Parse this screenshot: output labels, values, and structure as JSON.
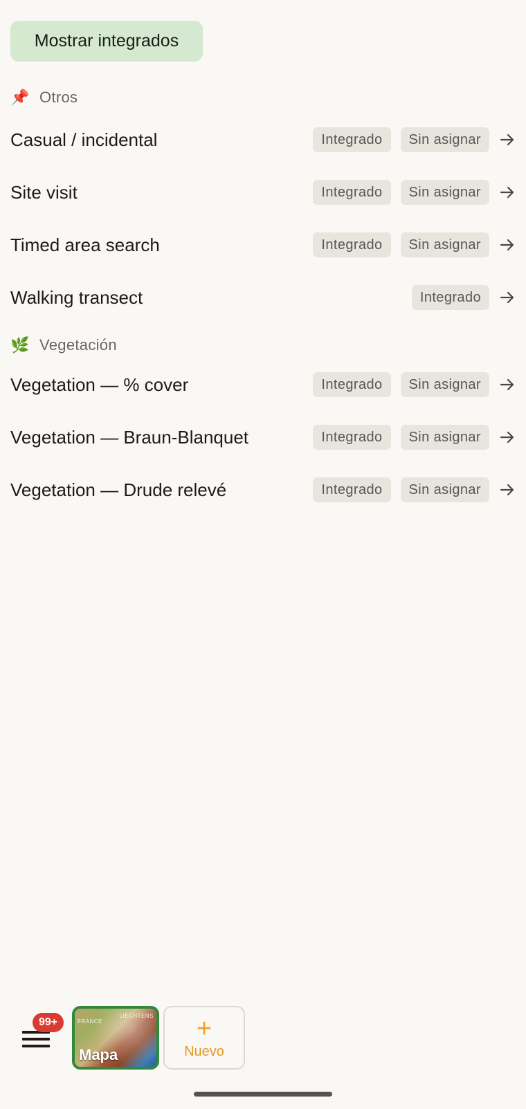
{
  "toggle_button": {
    "label": "Mostrar integrados"
  },
  "sections": [
    {
      "emoji": "📌",
      "title": "Otros",
      "items": [
        {
          "title": "Casual / incidental",
          "chips": [
            "Integrado",
            "Sin asignar"
          ]
        },
        {
          "title": "Site visit",
          "chips": [
            "Integrado",
            "Sin asignar"
          ]
        },
        {
          "title": "Timed area search",
          "chips": [
            "Integrado",
            "Sin asignar"
          ]
        },
        {
          "title": "Walking transect",
          "chips": [
            "Integrado"
          ]
        }
      ]
    },
    {
      "emoji": "🌿",
      "title": "Vegetación",
      "items": [
        {
          "title": "Vegetation — % cover",
          "chips": [
            "Integrado",
            "Sin asignar"
          ]
        },
        {
          "title": "Vegetation — Braun-Blanquet",
          "chips": [
            "Integrado",
            "Sin asignar"
          ]
        },
        {
          "title": "Vegetation — Drude relevé",
          "chips": [
            "Integrado",
            "Sin asignar"
          ]
        }
      ]
    }
  ],
  "bottom_bar": {
    "menu_icon": "hamburger-menu-icon",
    "badge": "99+",
    "map_button": {
      "label": "Mapa",
      "thumbnail_labels": [
        "FRANCE",
        "LIECHTENS"
      ]
    },
    "new_button": {
      "label": "Nuevo",
      "icon": "plus-icon"
    }
  },
  "colors": {
    "background": "#faf8f5",
    "toggle_bg": "#d5e8d0",
    "chip_bg": "#e8e4de",
    "badge": "#d93a32",
    "map_border": "#2f8a3c",
    "new_accent": "#f0a12c"
  }
}
